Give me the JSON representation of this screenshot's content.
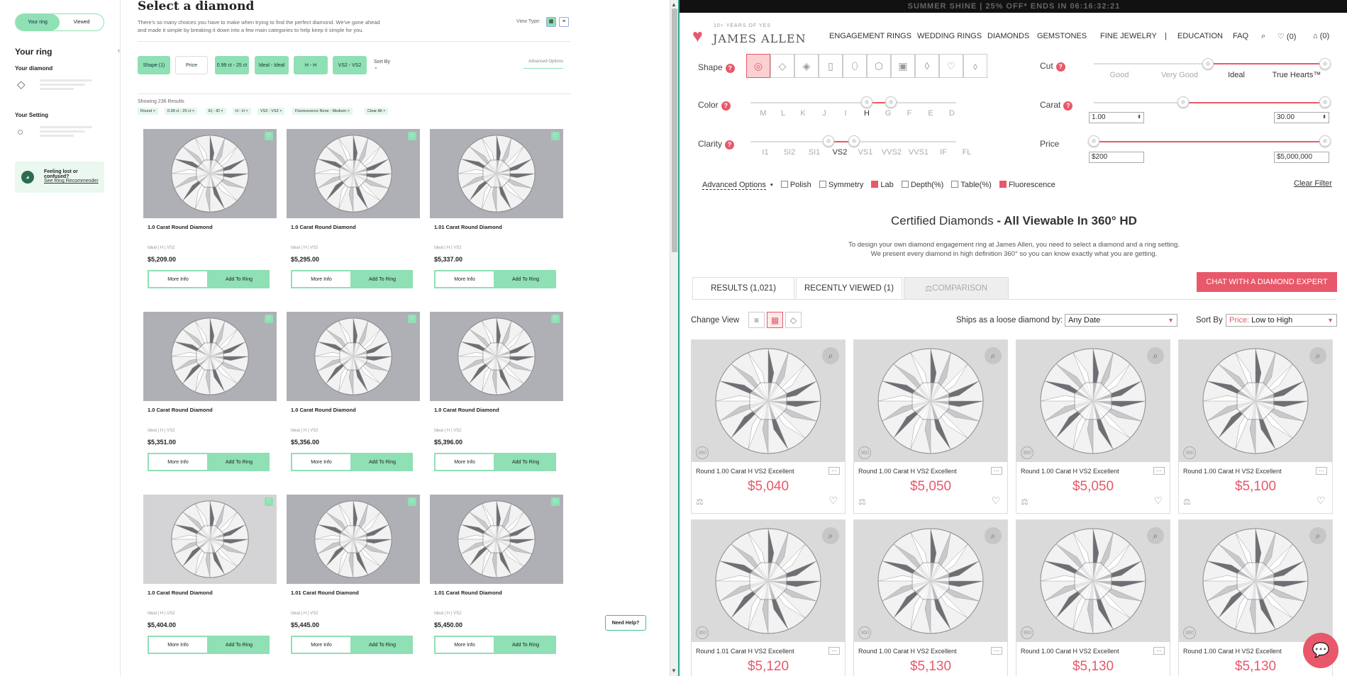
{
  "left": {
    "toggle": {
      "your_ring": "Your ring",
      "viewed": "Viewed"
    },
    "sidebar": {
      "title": "Your ring",
      "diamond_label": "Your diamond",
      "setting_label": "Your Setting",
      "help_title": "Feeling lost or confused?",
      "help_link": "See Ring Recommender"
    },
    "page_title": "Select a diamond",
    "intro": "There's so many choices you have to make when trying to find the perfect diamond. We've gone ahead and made it simple by breaking it down into a few main categories to help keep it simple for you.",
    "view_type_label": "View Type:",
    "filter_chips": [
      "Shape (1)",
      "Price",
      "0.99 ct - 25 ct",
      "Ideal - Ideal",
      "H - H",
      "VS2 - VS2"
    ],
    "sort_label": "Sort By",
    "advanced_label": "Advanced Options",
    "showing": "Showing 236 Results",
    "active_filters": [
      "Round ×",
      "0.99 ct - 25 ct ×",
      "E) - ID ×",
      "H - H ×",
      "VS2 - VS2 ×",
      "Fluorescence None - Medium ×",
      "Clear All ×"
    ],
    "more_info_label": "More Info",
    "add_label": "Add To Ring",
    "products": [
      {
        "name": "1.0 Carat Round Diamond",
        "spec": "Ideal | H | VS2",
        "price": "$5,209.00"
      },
      {
        "name": "1.0 Carat Round Diamond",
        "spec": "Ideal | H | VS2",
        "price": "$5,295.00"
      },
      {
        "name": "1.01 Carat Round Diamond",
        "spec": "Ideal | H | VS2",
        "price": "$5,337.00"
      },
      {
        "name": "1.0 Carat Round Diamond",
        "spec": "Ideal | H | VS2",
        "price": "$5,351.00"
      },
      {
        "name": "1.0 Carat Round Diamond",
        "spec": "Ideal | H | VS2",
        "price": "$5,356.00"
      },
      {
        "name": "1.0 Carat Round Diamond",
        "spec": "Ideal | H | VS2",
        "price": "$5,396.00"
      },
      {
        "name": "1.0 Carat Round Diamond",
        "spec": "Ideal | H | VS2",
        "price": "$5,404.00"
      },
      {
        "name": "1.01 Carat Round Diamond",
        "spec": "Ideal | H | VS2",
        "price": "$5,445.00"
      },
      {
        "name": "1.01 Carat Round Diamond",
        "spec": "Ideal | H | VS2",
        "price": "$5,450.00"
      }
    ],
    "need_help": "Need Help?"
  },
  "right": {
    "banner": "SUMMER SHINE | 25% OFF* ENDS IN 06:16:32:21",
    "logo_small": "10+ YEARS OF YES",
    "logo": "JAMES ALLEN",
    "nav": [
      "ENGAGEMENT RINGS",
      "WEDDING RINGS",
      "DIAMONDS",
      "GEMSTONES",
      "FINE JEWELRY",
      "|",
      "EDUCATION",
      "FAQ"
    ],
    "wishlist_count": "(0)",
    "cart_count": "(0)",
    "labels": {
      "shape": "Shape",
      "cut": "Cut",
      "color": "Color",
      "carat": "Carat",
      "clarity": "Clarity",
      "price": "Price"
    },
    "cut_grades": [
      "Good",
      "Very Good",
      "Ideal",
      "True Hearts™"
    ],
    "color_grades": [
      "M",
      "L",
      "K",
      "J",
      "I",
      "H",
      "G",
      "F",
      "E",
      "D"
    ],
    "clarity_grades": [
      "I1",
      "SI2",
      "SI1",
      "VS2",
      "VS1",
      "VVS2",
      "VVS1",
      "IF",
      "FL"
    ],
    "carat_min": "1.00",
    "carat_max": "30.00",
    "price_min": "$200",
    "price_max": "$5,000,000",
    "advanced_options": "Advanced Options",
    "checks": [
      {
        "label": "Polish",
        "on": false
      },
      {
        "label": "Symmetry",
        "on": false
      },
      {
        "label": "Lab",
        "on": true
      },
      {
        "label": "Depth(%)",
        "on": false
      },
      {
        "label": "Table(%)",
        "on": false
      },
      {
        "label": "Fluorescence",
        "on": true
      }
    ],
    "clear_filter": "Clear Filter",
    "cert_title": "Certified Diamonds",
    "cert_sub": " - All Viewable In 360° HD",
    "desc1": "To design your own diamond engagement ring at James Allen, you need to select a diamond and a ring setting.",
    "desc2": "We present every diamond in high definition 360° so you can know exactly what you are getting.",
    "tabs": [
      "RESULTS (1,021)",
      "RECENTLY VIEWED (1)",
      "COMPARISON"
    ],
    "chat_btn": "CHAT WITH A DIAMOND EXPERT",
    "change_view": "Change View",
    "ships_label": "Ships as a loose diamond by:",
    "ships_value": "Any Date",
    "sort_label": "Sort By",
    "sort_key": "Price:",
    "sort_value": " Low to High",
    "results": [
      {
        "name": "Round 1.00 Carat H VS2 Excellent",
        "price": "$5,040"
      },
      {
        "name": "Round 1.00 Carat H VS2 Excellent",
        "price": "$5,050"
      },
      {
        "name": "Round 1.00 Carat H VS2 Excellent",
        "price": "$5,050"
      },
      {
        "name": "Round 1.00 Carat H VS2 Excellent",
        "price": "$5,100"
      },
      {
        "name": "Round 1.01 Carat H VS2 Excellent",
        "price": "$5,120"
      },
      {
        "name": "Round 1.00 Carat H VS2 Excellent",
        "price": "$5,130"
      },
      {
        "name": "Round 1.00 Carat H VS2 Excellent",
        "price": "$5,130"
      },
      {
        "name": "Round 1.00 Carat H VS2 Excellent",
        "price": "$5,130"
      }
    ],
    "colors": {
      "accent": "#e8586a",
      "mint": "#8fe0b4"
    }
  }
}
